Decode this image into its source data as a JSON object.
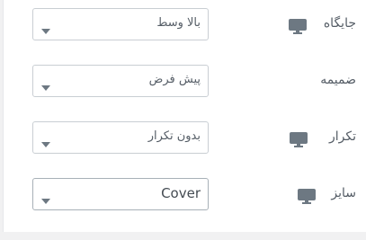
{
  "settings": [
    {
      "label": "جایگاه",
      "value": "بالا وسط",
      "responsive_icon": "desktop-icon"
    },
    {
      "label": "ضمیمه",
      "value": "پیش فرض",
      "responsive_icon": null
    },
    {
      "label": "تکرار",
      "value": "بدون تکرار",
      "responsive_icon": "desktop-icon"
    },
    {
      "label": "سایز",
      "value": "Cover",
      "responsive_icon": "desktop-icon"
    }
  ],
  "colors": {
    "text": "#555d66",
    "icon": "#6d7882",
    "border": "#c9ced3"
  }
}
